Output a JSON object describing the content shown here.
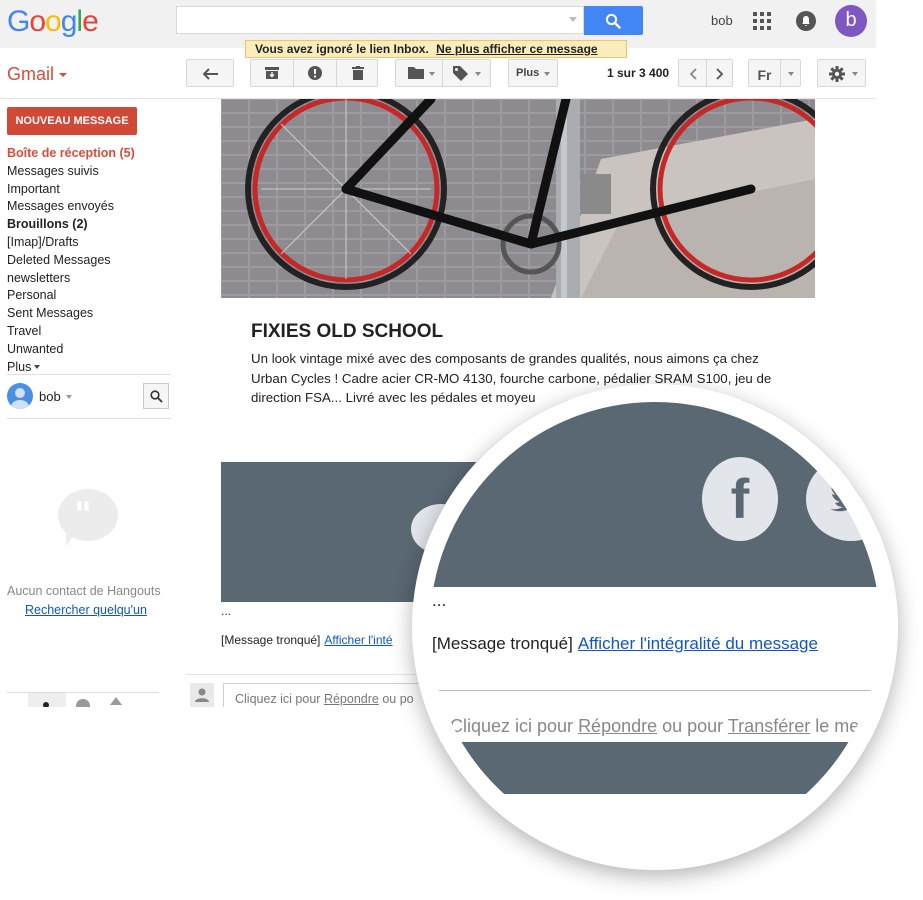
{
  "header": {
    "logo_letters": [
      {
        "ch": "G",
        "color": "#4285f4"
      },
      {
        "ch": "o",
        "color": "#ea4335"
      },
      {
        "ch": "o",
        "color": "#fbbc05"
      },
      {
        "ch": "g",
        "color": "#4285f4"
      },
      {
        "ch": "l",
        "color": "#34a853"
      },
      {
        "ch": "e",
        "color": "#ea4335"
      }
    ],
    "search_placeholder": "",
    "search_icon": "search-icon",
    "user_name": "bob",
    "avatar_letter": "b",
    "avatar_color": "#7e57c2"
  },
  "notice": {
    "text": "Vous avez ignoré le lien Inbox.",
    "link": "Ne plus afficher ce message"
  },
  "app_switcher": {
    "label": "Gmail",
    "color": "#dd4b39"
  },
  "toolbar": {
    "more_label": "Plus",
    "pager_pre": "1 sur ",
    "pager_total": "3 400",
    "lang": "Fr"
  },
  "sidebar": {
    "compose_label": "NOUVEAU MESSAGE",
    "compose_color": "#d14836",
    "items": [
      {
        "label": "Boîte de réception (5)",
        "style": "active"
      },
      {
        "label": "Messages suivis",
        "style": ""
      },
      {
        "label": "Important",
        "style": ""
      },
      {
        "label": "Messages envoyés",
        "style": ""
      },
      {
        "label": "Brouillons (2)",
        "style": "bold"
      },
      {
        "label": "[Imap]/Drafts",
        "style": ""
      },
      {
        "label": "Deleted Messages",
        "style": ""
      },
      {
        "label": "newsletters",
        "style": ""
      },
      {
        "label": "Personal",
        "style": ""
      },
      {
        "label": "Sent Messages",
        "style": ""
      },
      {
        "label": "Travel",
        "style": ""
      },
      {
        "label": "Unwanted",
        "style": ""
      }
    ],
    "more_label": "Plus",
    "hangouts_user": "bob",
    "hangouts_empty": "Aucun contact de Hangouts",
    "hangouts_search_link": "Rechercher quelqu'un"
  },
  "email": {
    "title": "FIXIES OLD SCHOOL",
    "body": "Un look vintage mixé avec des composants de grandes qualités, nous aimons ça chez Urban Cycles ! Cadre acier CR-MO 4130, fourche carbone, pédalier SRAM S100, jeu de direction FSA... Livré avec les pédales et moyeu",
    "ellipsis": "...",
    "truncated_label": "[Message tronqué]",
    "show_full_link": "Afficher l'intégralité du message",
    "show_full_short": "Afficher l'inté",
    "banner_color": "#5a6874"
  },
  "reply": {
    "pre": "Cliquez ici pour ",
    "reply_link": "Répondre",
    "mid": " ou pour ",
    "forward_link": "Transférer",
    "post": " le message",
    "short_mid": " ou po"
  },
  "magnifier": {
    "facebook_glyph": "f",
    "facebook_icon": "facebook-icon",
    "twitter_icon": "twitter-icon"
  }
}
